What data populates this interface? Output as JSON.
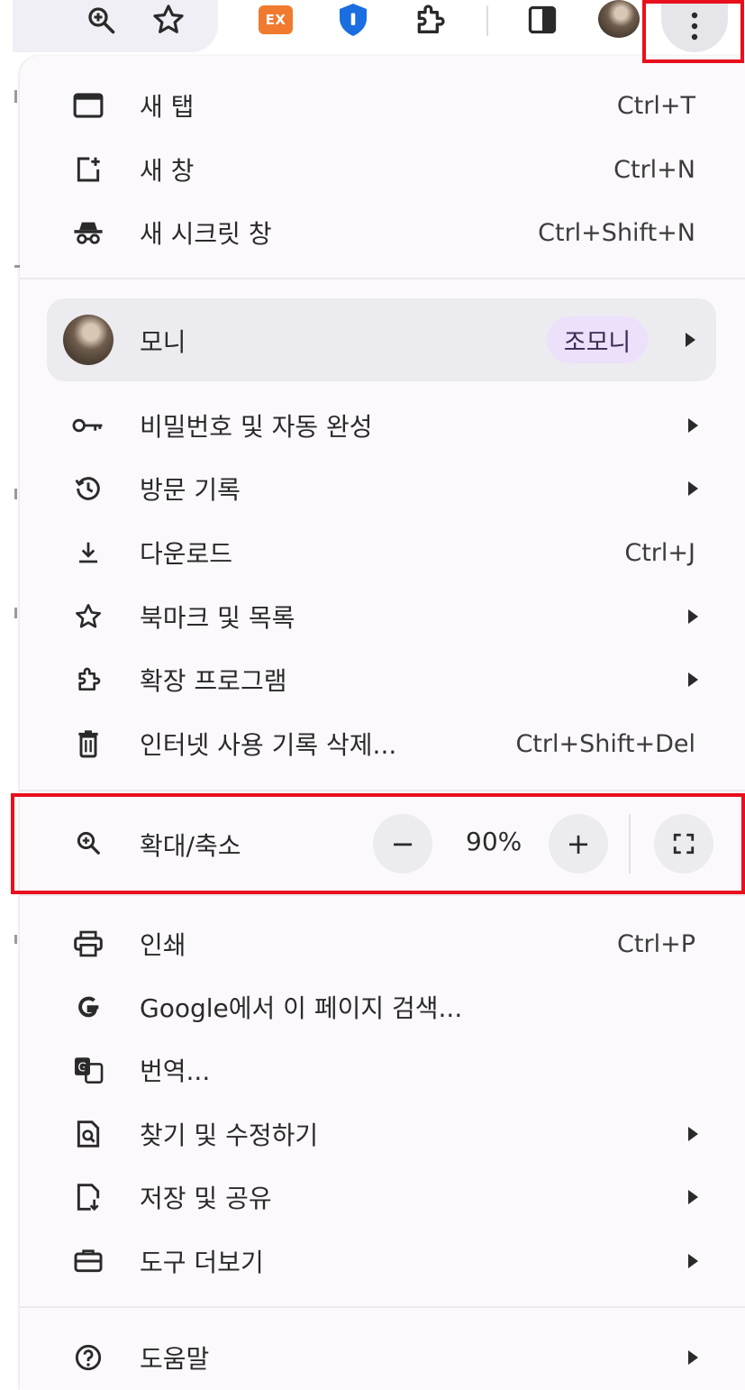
{
  "toolbar": {
    "icons": [
      "zoom-icon",
      "star-icon",
      "extension-ex-icon",
      "password-manager-shield-icon",
      "extensions-puzzle-icon",
      "side-panel-icon",
      "profile-avatar",
      "more-menu-icon"
    ],
    "ex_badge": "EX"
  },
  "menu": {
    "new_tab": {
      "label": "새 탭",
      "shortcut": "Ctrl+T"
    },
    "new_window": {
      "label": "새 창",
      "shortcut": "Ctrl+N"
    },
    "incognito": {
      "label": "새 시크릿 창",
      "shortcut": "Ctrl+Shift+N"
    },
    "profile": {
      "name": "모니",
      "account_chip": "조모니"
    },
    "passwords": {
      "label": "비밀번호 및 자동 완성"
    },
    "history": {
      "label": "방문 기록"
    },
    "downloads": {
      "label": "다운로드",
      "shortcut": "Ctrl+J"
    },
    "bookmarks": {
      "label": "북마크 및 목록"
    },
    "extensions": {
      "label": "확장 프로그램"
    },
    "clear_data": {
      "label": "인터넷 사용 기록 삭제...",
      "shortcut": "Ctrl+Shift+Del"
    },
    "zoom": {
      "label": "확대/축소",
      "minus": "−",
      "value": "90%",
      "plus": "+"
    },
    "print": {
      "label": "인쇄",
      "shortcut": "Ctrl+P"
    },
    "google_search": {
      "label": "Google에서 이 페이지 검색..."
    },
    "translate": {
      "label": "번역..."
    },
    "find_edit": {
      "label": "찾기 및 수정하기"
    },
    "save_share": {
      "label": "저장 및 공유"
    },
    "more_tools": {
      "label": "도구 더보기"
    },
    "help": {
      "label": "도움말"
    }
  },
  "colors": {
    "highlight_box": "#e8101c",
    "menu_bg": "#fcf9fd",
    "profile_chip": "#ede0fa",
    "ex_badge": "#f07a2e",
    "shield": "#1a6ee0"
  }
}
